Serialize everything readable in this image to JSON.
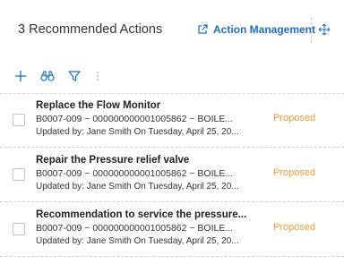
{
  "header": {
    "title": "3  Recommended Actions",
    "action_link_label": "Action Management"
  },
  "colors": {
    "accent": "#1b6fc6",
    "status": "#f39a2d"
  },
  "toolbar": {
    "icons": [
      "plus-icon",
      "binoculars-icon",
      "filter-icon",
      "more-vertical-icon"
    ]
  },
  "rows": [
    {
      "title": "Replace the Flow Monitor",
      "id_line": "B0007-009 ~ 000000000001005862 ~ BOILE...",
      "updated": "Updated by: Jane Smith On  Tuesday, April 25, 20...",
      "status": "Proposed"
    },
    {
      "title": "Repair the Pressure relief valve",
      "id_line": "B0007-009 ~ 000000000001005862 ~ BOILE...",
      "updated": "Updated by: Jane Smith On  Tuesday, April 25, 20...",
      "status": "Proposed"
    },
    {
      "title": "Recommendation to service the pressure...",
      "id_line": "B0007-009 ~ 000000000001005862 ~ BOILE...",
      "updated": "Updated by: Jane Smith On  Tuesday, April 25, 20...",
      "status": "Proposed"
    }
  ]
}
